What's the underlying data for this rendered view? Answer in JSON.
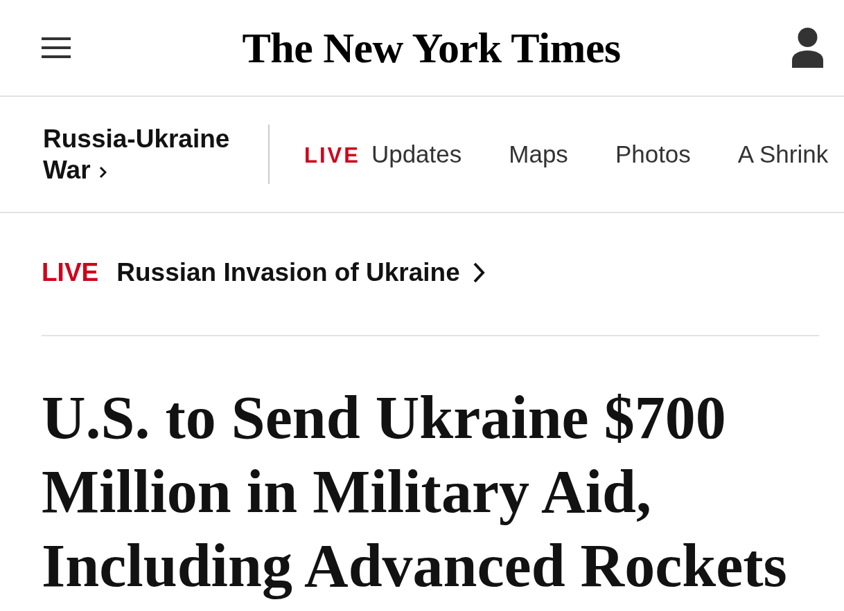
{
  "header": {
    "logo": "The New York Times"
  },
  "section_nav": {
    "section": "Russia-Ukraine War",
    "items": [
      {
        "kind": "live",
        "badge": "LIVE",
        "label": "Updates"
      },
      {
        "kind": "link",
        "label": "Maps"
      },
      {
        "kind": "link",
        "label": "Photos"
      },
      {
        "kind": "link",
        "label": "A Shrink"
      }
    ]
  },
  "live_banner": {
    "badge": "LIVE",
    "title": "Russian Invasion of Ukraine"
  },
  "article": {
    "headline": "U.S. to Send Ukraine $700 Million in Military Aid, Including Advanced Rockets"
  }
}
